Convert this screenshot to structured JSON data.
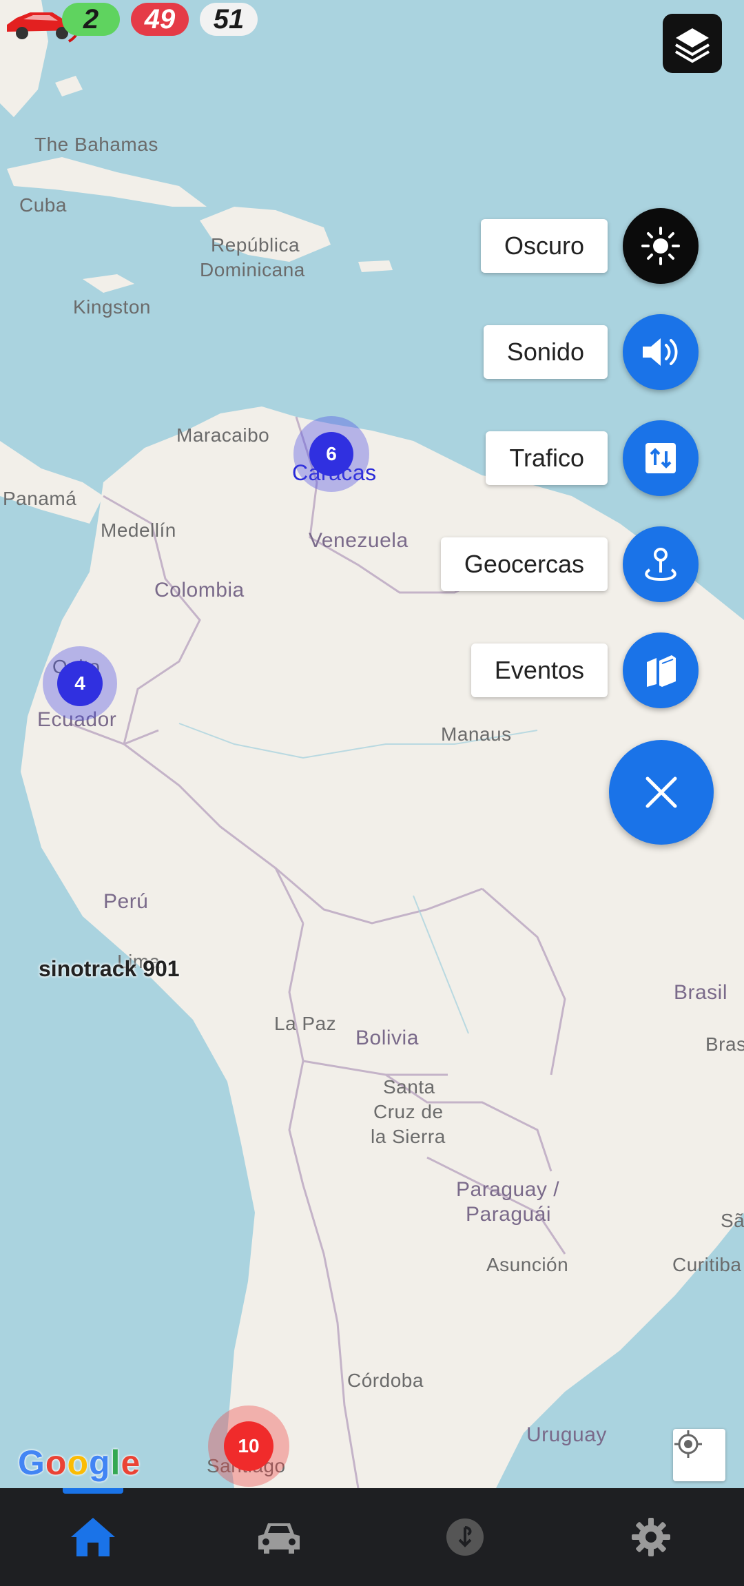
{
  "counters": {
    "online": "2",
    "offline": "49",
    "total": "51"
  },
  "map_labels": {
    "bahamas": "The Bahamas",
    "cuba": "Cuba",
    "rep_dominicana_1": "República",
    "rep_dominicana_2": "Dominicana",
    "kingston": "Kingston",
    "maracaibo": "Maracaibo",
    "caracas": "Caracas",
    "panama": "Panamá",
    "medellin": "Medellín",
    "venezuela": "Venezuela",
    "colombia": "Colombia",
    "quito": "Quito",
    "ecuador": "Ecuador",
    "manaus": "Manaus",
    "peru": "Perú",
    "lima": "Lima",
    "brasil": "Brasil",
    "brasilia": "Brasília",
    "la_paz": "La Paz",
    "bolivia": "Bolivia",
    "santa_cruz_1": "Santa",
    "santa_cruz_2": "Cruz de",
    "santa_cruz_3": "la Sierra",
    "paraguay_1": "Paraguay /",
    "paraguay_2": "Paraguái",
    "asuncion": "Asunción",
    "sao": "São",
    "curitiba": "Curitiba",
    "cordoba": "Córdoba",
    "uruguay": "Uruguay",
    "santiago": "Santiago"
  },
  "speed_dial": [
    {
      "label": "Oscuro",
      "icon": "sun-icon"
    },
    {
      "label": "Sonido",
      "icon": "volume-icon"
    },
    {
      "label": "Trafico",
      "icon": "traffic-icon"
    },
    {
      "label": "Geocercas",
      "icon": "geofence-icon"
    },
    {
      "label": "Eventos",
      "icon": "events-icon"
    }
  ],
  "clusters": {
    "caracas": "6",
    "quito": "4",
    "santiago": "10"
  },
  "vehicle": {
    "name": "sinotrack 901"
  },
  "attribution": {
    "g1": "G",
    "g2": "o",
    "g3": "o",
    "g4": "g",
    "g5": "l",
    "g6": "e"
  },
  "nav": [
    {
      "name": "home",
      "icon": "home-icon",
      "active": true
    },
    {
      "name": "vehicles",
      "icon": "car-icon"
    },
    {
      "name": "history",
      "icon": "history-icon"
    },
    {
      "name": "settings",
      "icon": "gear-icon"
    }
  ],
  "colors": {
    "accent": "#1a73e8",
    "online": "#5fd35f",
    "offline": "#e53b47",
    "sea": "#aad3df",
    "land": "#f2efe9"
  }
}
